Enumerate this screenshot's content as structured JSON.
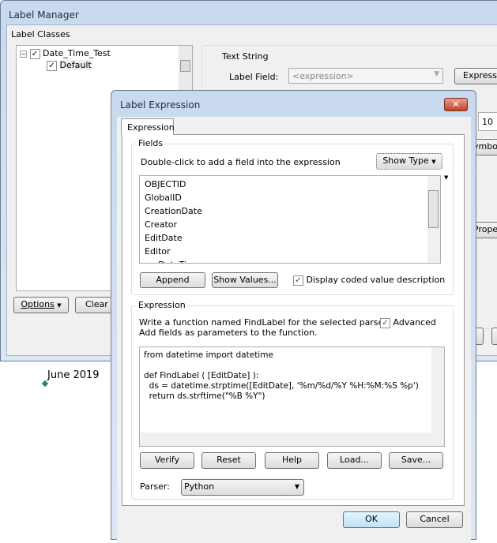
{
  "label_manager": {
    "title": "Label Manager",
    "label_classes": "Label Classes",
    "tree": [
      {
        "label": "Date_Time_Test",
        "checked": true
      },
      {
        "label": "Default",
        "checked": true
      }
    ],
    "text_string": "Text String",
    "label_field_label": "Label Field:",
    "label_field_value": "<expression>",
    "expression_button": "Expressio",
    "size_value": "10",
    "symbol_button": "ymbo",
    "properties_button": "Proper",
    "options_button": "Options",
    "clear_button": "Clear A"
  },
  "map": {
    "label": "June 2019",
    "point_color": "#2e8b57"
  },
  "dialog": {
    "title": "Label Expression",
    "tab": "Expression",
    "fields_group": "Fields",
    "fields_hint": "Double-click to add a field into the expression",
    "show_type": "Show Type",
    "fields": [
      "OBJECTID",
      "GlobalID",
      "CreationDate",
      "Creator",
      "EditDate",
      "Editor",
      "myDateTime"
    ],
    "append": "Append",
    "show_values": "Show Values...",
    "display_coded": "Display coded value description",
    "display_coded_checked": true,
    "expression_group": "Expression",
    "expr_hint1": "Write a function named FindLabel for the selected parser.",
    "expr_hint2": "Add fields as parameters to the function.",
    "advanced": "Advanced",
    "advanced_checked": true,
    "code": "from datetime import datetime\n\ndef FindLabel ( [EditDate] ):\n  ds = datetime.strptime([EditDate], '%m/%d/%Y %H:%M:%S %p')\n  return ds.strftime(\"%B %Y\")",
    "verify": "Verify",
    "reset": "Reset",
    "help": "Help",
    "load": "Load...",
    "save": "Save...",
    "parser_label": "Parser:",
    "parser_value": "Python",
    "ok": "OK",
    "cancel": "Cancel"
  }
}
